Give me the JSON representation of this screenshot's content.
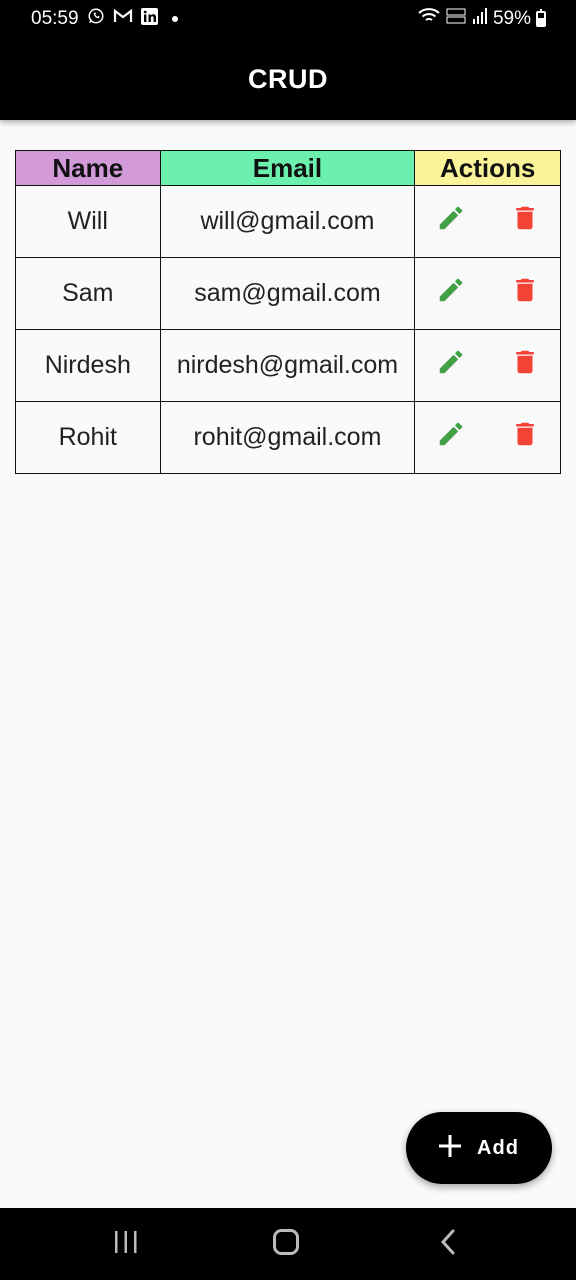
{
  "status_bar": {
    "time": "05:59",
    "battery": "59%",
    "notification_icons": [
      "whatsapp-icon",
      "gmail-icon",
      "linkedin-icon",
      "dot-icon"
    ],
    "system_icons": [
      "wifi-icon",
      "volte-lte2-icon",
      "signal-icon",
      "battery-icon"
    ]
  },
  "app_bar": {
    "title": "CRUD"
  },
  "table": {
    "headers": {
      "name": "Name",
      "email": "Email",
      "actions": "Actions"
    },
    "header_colors": {
      "name": "#d39ad9",
      "email": "#6bf0ad",
      "actions": "#fbf39a"
    },
    "action_colors": {
      "edit": "#43a047",
      "delete": "#f44336"
    },
    "rows": [
      {
        "name": "Will",
        "email": "will@gmail.com"
      },
      {
        "name": "Sam",
        "email": "sam@gmail.com"
      },
      {
        "name": "Nirdesh",
        "email": "nirdesh@gmail.com"
      },
      {
        "name": "Rohit",
        "email": "rohit@gmail.com"
      }
    ]
  },
  "fab": {
    "label": "Add",
    "icon": "plus-icon"
  },
  "nav_bar": {
    "icons": [
      "recents-icon",
      "home-icon",
      "back-icon"
    ]
  }
}
